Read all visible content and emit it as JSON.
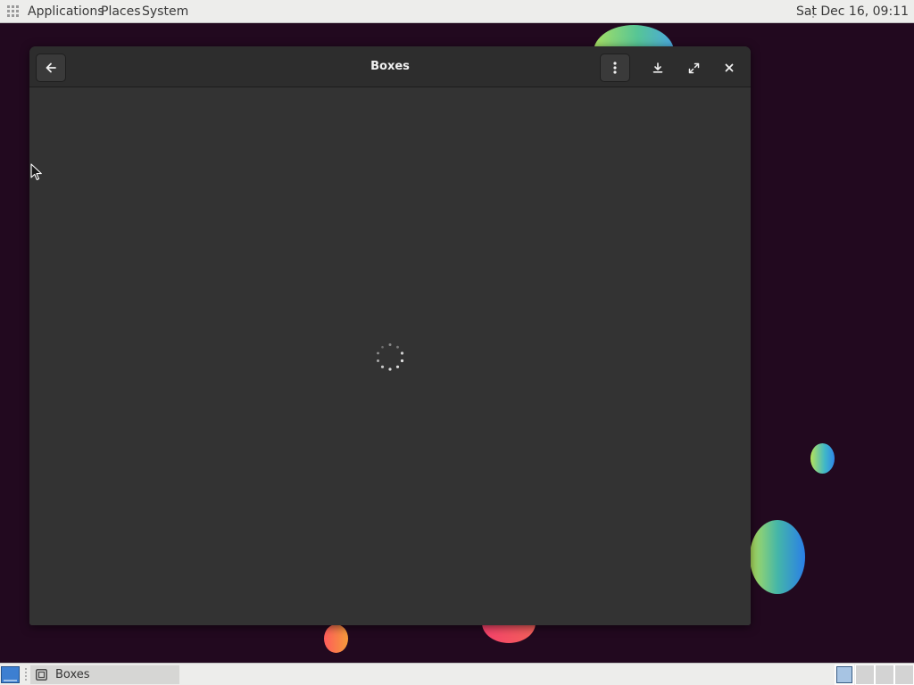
{
  "top_panel": {
    "menus": {
      "applications": "Applications",
      "places": "Places",
      "system": "System"
    },
    "clock": "Sat Dec 16, 09:11"
  },
  "window": {
    "title": "Boxes",
    "state": "loading",
    "icons": {
      "back": "arrow-left-icon",
      "menu": "vertical-dots-icon",
      "download": "download-icon",
      "fullscreen": "fullscreen-icon",
      "close": "close-icon"
    }
  },
  "taskbar": {
    "items": [
      {
        "label": "Boxes",
        "icon": "boxes-app-icon"
      }
    ],
    "workspaces": {
      "count": 4,
      "active_index": 1
    }
  },
  "colors": {
    "desktop_background": "#22091f",
    "window_background": "#333333",
    "headerbar_background": "#2d2d2d",
    "panel_background": "#ededeb"
  }
}
